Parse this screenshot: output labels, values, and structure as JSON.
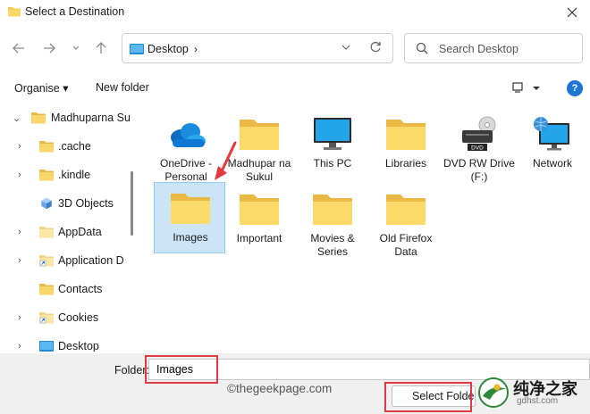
{
  "window": {
    "title": "Select a Destination",
    "close_icon": "close-icon"
  },
  "nav": {
    "back_icon": "back-arrow-icon",
    "forward_icon": "forward-arrow-icon",
    "recent_icon": "chevron-down-icon",
    "up_icon": "up-arrow-icon"
  },
  "address": {
    "location": "Desktop",
    "separator": "›"
  },
  "search": {
    "placeholder": "Search Desktop"
  },
  "commands": {
    "organise_label": "Organise ▾",
    "new_folder_label": "New folder",
    "help_label": "?"
  },
  "sidebar": {
    "items": [
      {
        "label": "Madhuparna Su",
        "icon": "folder-icon",
        "expanded": true
      },
      {
        "label": ".cache",
        "icon": "folder-icon"
      },
      {
        "label": ".kindle",
        "icon": "folder-icon"
      },
      {
        "label": "3D Objects",
        "icon": "3d-objects-icon"
      },
      {
        "label": "AppData",
        "icon": "folder-icon"
      },
      {
        "label": "Application D",
        "icon": "shortcut-folder-icon"
      },
      {
        "label": "Contacts",
        "icon": "folder-icon"
      },
      {
        "label": "Cookies",
        "icon": "shortcut-folder-icon"
      },
      {
        "label": "Desktop",
        "icon": "desktop-icon"
      }
    ]
  },
  "content": {
    "items": [
      {
        "label": "OneDrive - Personal",
        "icon": "onedrive-cloud-icon"
      },
      {
        "label": "Madhupar na Sukul",
        "icon": "folder-icon"
      },
      {
        "label": "This PC",
        "icon": "monitor-icon"
      },
      {
        "label": "Libraries",
        "icon": "folder-icon"
      },
      {
        "label": "DVD RW Drive (F:)",
        "icon": "dvd-drive-icon",
        "badge": "DVD"
      },
      {
        "label": "Network",
        "icon": "network-icon"
      },
      {
        "label": "Images",
        "icon": "folder-icon",
        "selected": true
      },
      {
        "label": "Important",
        "icon": "folder-icon"
      },
      {
        "label": "Movies & Series",
        "icon": "folder-icon"
      },
      {
        "label": "Old Firefox Data",
        "icon": "folder-icon"
      }
    ]
  },
  "footer": {
    "folder_label": "Folder:",
    "folder_value": "Images",
    "select_button": "Select Folder",
    "watermark": "©thegeekpage.com",
    "brand_name": "纯净之家",
    "brand_url": "gdhst.com"
  },
  "colors": {
    "accent": "#1f75d6",
    "highlight": "#e0393e",
    "selection": "#cce4f7",
    "folder": "#f8d775"
  }
}
